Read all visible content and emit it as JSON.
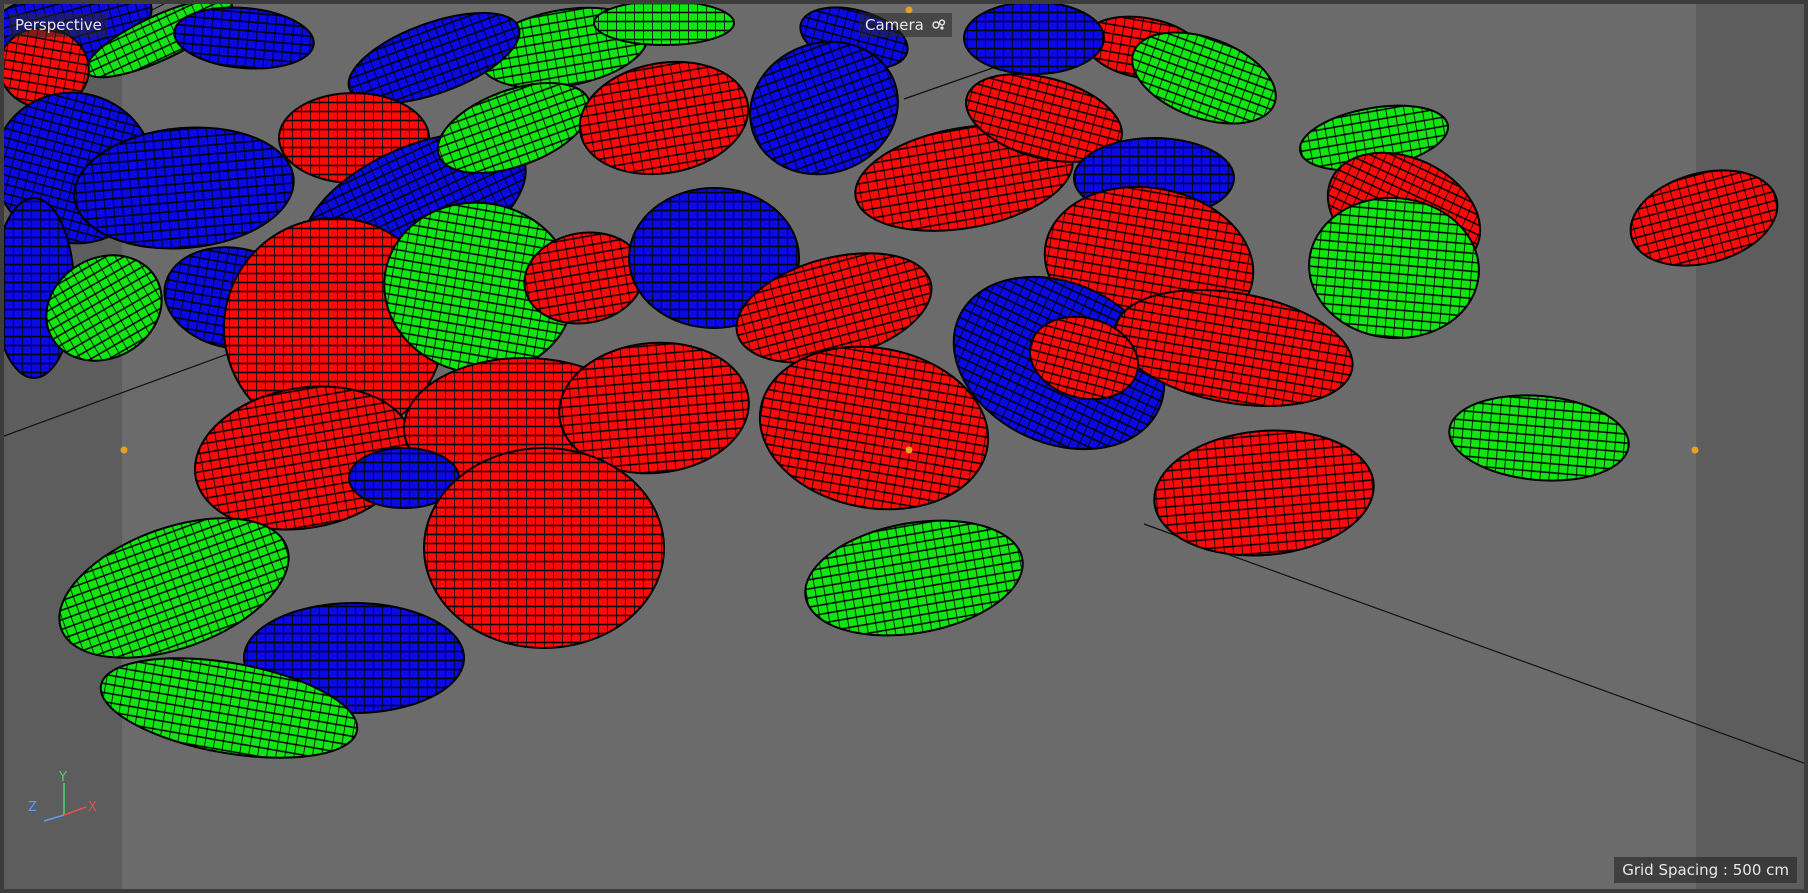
{
  "viewport": {
    "view_name": "Perspective",
    "camera_label": "Camera",
    "grid_spacing": "Grid Spacing : 500 cm"
  },
  "axes": {
    "x": "X",
    "y": "Y",
    "z": "Z"
  },
  "icons": {
    "camera": "camera-icon",
    "axis_gizmo": "axis-gizmo-icon"
  },
  "colors": {
    "background": "#6b6b6b",
    "safe_frame_dim": "#5a5a5a",
    "red_petal": "#ff0a0a",
    "green_petal": "#12e612",
    "blue_petal": "#0a0ae6",
    "wire": "#000000",
    "handle": "#e8a020"
  }
}
